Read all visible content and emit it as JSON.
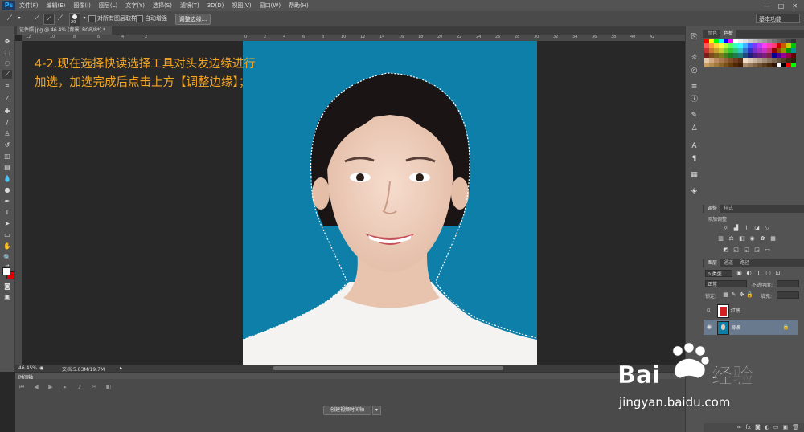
{
  "app": {
    "logo": "Ps"
  },
  "menu": [
    "文件(F)",
    "编辑(E)",
    "图像(I)",
    "图层(L)",
    "文字(Y)",
    "选择(S)",
    "滤镜(T)",
    "3D(D)",
    "视图(V)",
    "窗口(W)",
    "帮助(H)"
  ],
  "window_controls": [
    "—",
    "□",
    "✕"
  ],
  "options": {
    "brush_size": "20",
    "sample_all_layers_label": "对所有图层取样",
    "auto_enhance_label": "自动增强",
    "refine_edge_button": "调整边缘...",
    "workspace": "基本功能"
  },
  "document": {
    "tab_title": "证件照.jpg @ 46.4% (背景, RGB/8*) *",
    "tab_close": "×"
  },
  "ruler_top": [
    "12",
    "10",
    "8",
    "6",
    "4",
    "2",
    "0",
    "2",
    "4",
    "6",
    "8",
    "10",
    "12",
    "14",
    "16",
    "18",
    "20",
    "22",
    "24",
    "26",
    "28",
    "30",
    "32",
    "34",
    "36",
    "38",
    "40",
    "42"
  ],
  "annotation": {
    "line1": "4-2.现在选择快读选择工具对头发边缘进行",
    "line2": "加选，加选完成后点击上方【调整边缘】；"
  },
  "status": {
    "zoom": "46.45%",
    "doc_size": "文档:5.83M/19.7M"
  },
  "timeline": {
    "tab_label": "时间轴",
    "create_button": "创建视频时间轴"
  },
  "swatches_panel": {
    "tabs": [
      "颜色",
      "色板"
    ],
    "colors": [
      "#ff0000",
      "#ffff00",
      "#00ff00",
      "#00ffff",
      "#0000ff",
      "#ff00ff",
      "#ffffff",
      "#eeeeee",
      "#dddddd",
      "#cccccc",
      "#bbbbbb",
      "#aaaaaa",
      "#999999",
      "#888888",
      "#777777",
      "#666666",
      "#555555",
      "#444444",
      "#333333",
      "#ff5a5a",
      "#ff9a3c",
      "#ffd23c",
      "#fff53c",
      "#b4ff3c",
      "#5aff5a",
      "#3cffb4",
      "#3cf5ff",
      "#3cb4ff",
      "#3c5aff",
      "#783cff",
      "#b43cff",
      "#ff3cf5",
      "#ff3cb4",
      "#ff3c78",
      "#c80000",
      "#c85a00",
      "#c8c800",
      "#00c800",
      "#c83232",
      "#c87832",
      "#c8a032",
      "#c8c832",
      "#78c832",
      "#32c832",
      "#32c878",
      "#32c8c8",
      "#3278c8",
      "#3232c8",
      "#7832c8",
      "#a032c8",
      "#c832c8",
      "#c83278",
      "#960000",
      "#964b00",
      "#969600",
      "#009600",
      "#009696",
      "#7d1e1e",
      "#7d4b1e",
      "#7d641e",
      "#7d7d1e",
      "#4b7d1e",
      "#1e7d1e",
      "#1e7d4b",
      "#1e7d7d",
      "#1e4b7d",
      "#1e1e7d",
      "#4b1e7d",
      "#641e7d",
      "#7d1e7d",
      "#7d1e4b",
      "#000096",
      "#4b0096",
      "#960096",
      "#96004b",
      "#640000",
      "#e6c8aa",
      "#d2aa82",
      "#be8c64",
      "#aa7850",
      "#96643c",
      "#825028",
      "#6e3c1e",
      "#5a2d14",
      "#f0dcc8",
      "#dcc8b4",
      "#c8b4a0",
      "#b4a08c",
      "#a08c78",
      "#8c7864",
      "#786450",
      "#64503c",
      "#503c28",
      "#3c2814",
      "#281e0a",
      "#c8a064",
      "#b48c50",
      "#a0783c",
      "#8c6428",
      "#785014",
      "#643c0a",
      "#502800",
      "#3c1e00",
      "#aa8c6e",
      "#96785a",
      "#826446",
      "#6e5032",
      "#5a3c1e",
      "#46280a",
      "#321400",
      "#ffffff",
      "#000000",
      "#ff0000",
      "#00ff00"
    ]
  },
  "adjustments_panel": {
    "tabs": [
      "调整",
      "样式"
    ],
    "title": "添加调整"
  },
  "layers_panel": {
    "tabs": [
      "图层",
      "通道",
      "路径"
    ],
    "filter": "ρ 类型",
    "blend_mode": "正常",
    "opacity_label": "不透明度:",
    "lock_label": "锁定:",
    "fill_label": "填充:",
    "layers": [
      {
        "name": "红底",
        "visible": false
      },
      {
        "name": "背景",
        "visible": true,
        "selected": true
      }
    ]
  },
  "watermark": {
    "brand_a": "Bai",
    "brand_b": "经验",
    "url": "jingyan.baidu.com"
  }
}
